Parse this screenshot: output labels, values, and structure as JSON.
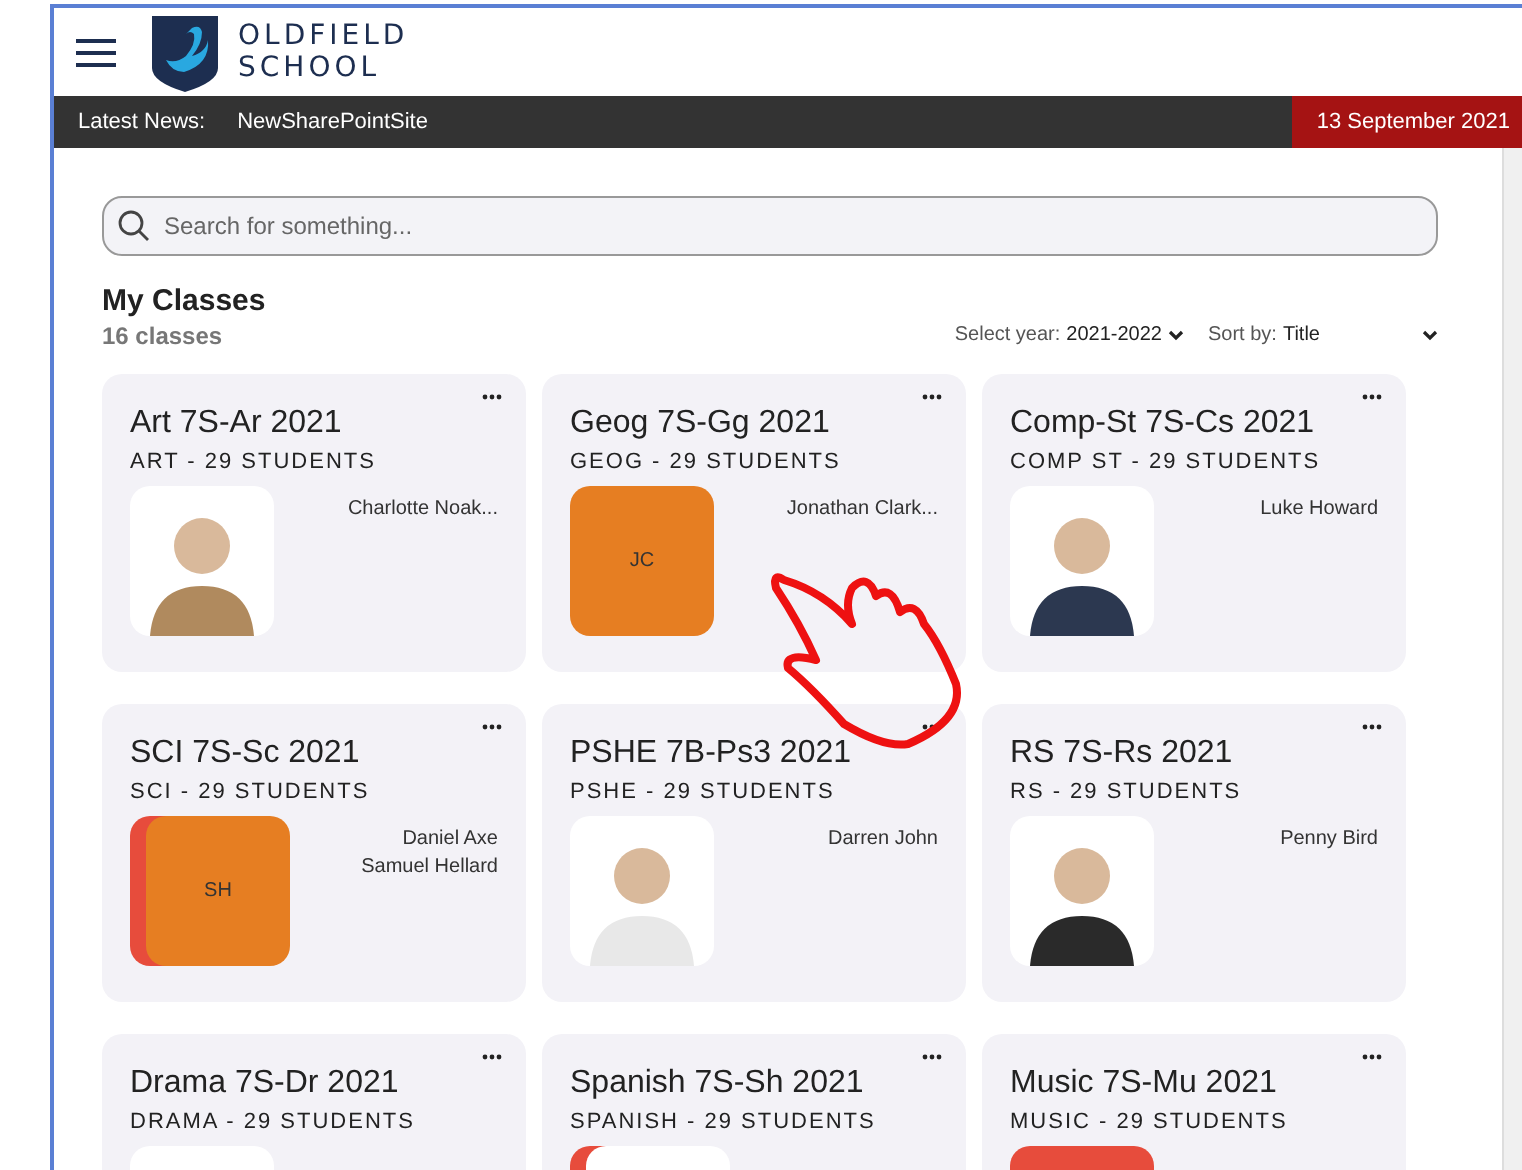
{
  "header": {
    "school_name_lines": [
      "OLDFIELD",
      "SCHOOL"
    ]
  },
  "news_bar": {
    "label": "Latest News:",
    "item": "NewSharePointSite",
    "date": "13 September 2021"
  },
  "search": {
    "placeholder": "Search for something..."
  },
  "classes_section": {
    "title": "My Classes",
    "count": "16 classes",
    "year_filter": {
      "label": "Select year:",
      "value": "2021-2022"
    },
    "sort": {
      "label": "Sort by:",
      "value": "Title"
    }
  },
  "classes": [
    {
      "title": "Art 7S-Ar 2021",
      "subtitle": "ART - 29 STUDENTS",
      "teachers": [
        "Charlotte Noak..."
      ],
      "avatars": [
        {
          "kind": "photo",
          "color": "#b08a5e"
        }
      ]
    },
    {
      "title": "Geog 7S-Gg 2021",
      "subtitle": "GEOG - 29 STUDENTS",
      "teachers": [
        "Jonathan Clark..."
      ],
      "avatars": [
        {
          "kind": "initials",
          "initials": "JC",
          "color": "#e67e22"
        }
      ]
    },
    {
      "title": "Comp-St 7S-Cs 2021",
      "subtitle": "COMP ST - 29 STUDENTS",
      "teachers": [
        "Luke Howard"
      ],
      "avatars": [
        {
          "kind": "photo",
          "color": "#2c3850"
        }
      ]
    },
    {
      "title": "SCI 7S-Sc 2021",
      "subtitle": "SCI - 29 STUDENTS",
      "teachers": [
        "Daniel Axe",
        "Samuel Hellard"
      ],
      "avatars": [
        {
          "kind": "initials",
          "color": "#e74c3c"
        },
        {
          "kind": "initials",
          "initials": "SH",
          "color": "#e67e22"
        }
      ]
    },
    {
      "title": "PSHE 7B-Ps3 2021",
      "subtitle": "PSHE - 29 STUDENTS",
      "teachers": [
        "Darren John"
      ],
      "avatars": [
        {
          "kind": "photo",
          "color": "#e8e8e8"
        }
      ]
    },
    {
      "title": "RS 7S-Rs 2021",
      "subtitle": "RS - 29 STUDENTS",
      "teachers": [
        "Penny Bird"
      ],
      "avatars": [
        {
          "kind": "photo",
          "color": "#2a2a2a"
        }
      ]
    },
    {
      "title": "Drama 7S-Dr 2021",
      "subtitle": "DRAMA - 29 STUDENTS",
      "avatars": [
        {
          "kind": "photo"
        }
      ]
    },
    {
      "title": "Spanish 7S-Sh 2021",
      "subtitle": "SPANISH - 29 STUDENTS",
      "avatars": [
        {
          "kind": "initials",
          "color": "#e74c3c"
        },
        {
          "kind": "photo"
        }
      ]
    },
    {
      "title": "Music 7S-Mu 2021",
      "subtitle": "MUSIC - 29 STUDENTS",
      "avatars": [
        {
          "kind": "initials",
          "color": "#e74c3c"
        }
      ]
    }
  ]
}
